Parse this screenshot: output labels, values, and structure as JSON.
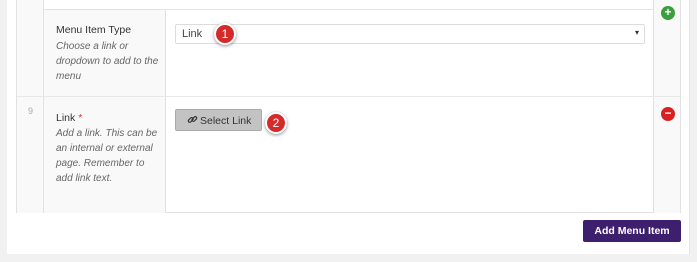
{
  "rows": [
    {
      "number": "",
      "label": "Menu Item Type",
      "description": "Choose a link or dropdown to add to the menu",
      "select_value": "Link"
    },
    {
      "number": "9",
      "label": "Link",
      "required_mark": "*",
      "description": "Add a link. This can be an internal or external page. Remember to add link text.",
      "button_label": "Select Link"
    }
  ],
  "badges": [
    "1",
    "2"
  ],
  "add_row_symbol": "+",
  "remove_row_symbol": "−",
  "add_menu_item_label": "Add Menu Item",
  "icons": {
    "select_arrow": "▾",
    "link": "🔗"
  },
  "colors": {
    "primary_button": "#3e1f6e",
    "badge": "#d42a2a",
    "add": "#3c9e3c",
    "remove": "#d92121"
  }
}
